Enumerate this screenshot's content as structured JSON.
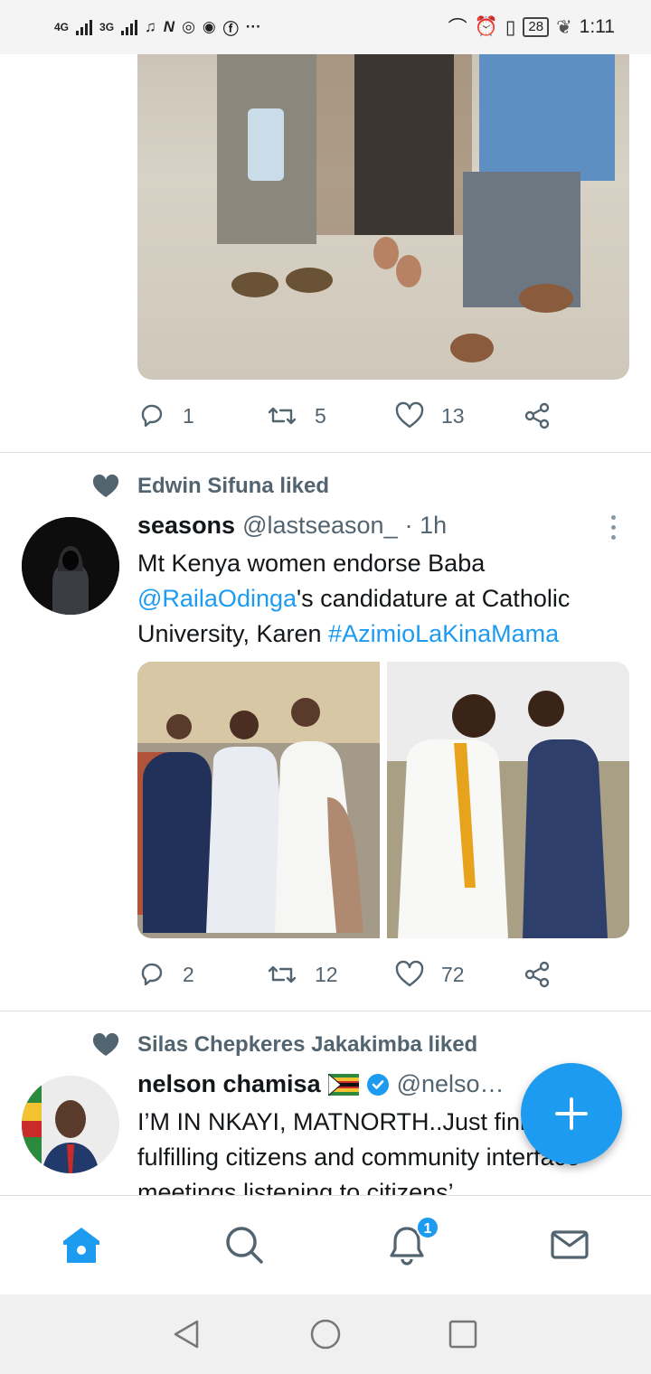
{
  "status_bar": {
    "net1": "4G",
    "net2": "3G",
    "battery": "28",
    "time": "1:11",
    "more": "···"
  },
  "tweets": [
    {
      "photo_desc_icon": "image",
      "stats": {
        "replies": "1",
        "retweets": "5",
        "likes": "13"
      }
    },
    {
      "liked_by": "Edwin Sifuna liked",
      "name": "seasons",
      "handle": "@lastseason_",
      "time": "· 1h",
      "text_1": "Mt Kenya women endorse Baba ",
      "mention": "@RailaOdinga",
      "text_2": "'s candidature at Catholic University, Karen ",
      "hashtag": "#AzimioLaKinaMama",
      "stats": {
        "replies": "2",
        "retweets": "12",
        "likes": "72"
      }
    },
    {
      "liked_by": "Silas Chepkeres Jakakimba liked",
      "name": "nelson chamisa",
      "handle": "@nelso…",
      "text": "I’M IN NKAYI, MATNORTH..Just finished fulfilling citizens and community interface meetings listening to citizens’"
    }
  ],
  "nav": {
    "notifications_badge": "1"
  },
  "colors": {
    "accent": "#1d9bf0",
    "muted": "#536471"
  }
}
